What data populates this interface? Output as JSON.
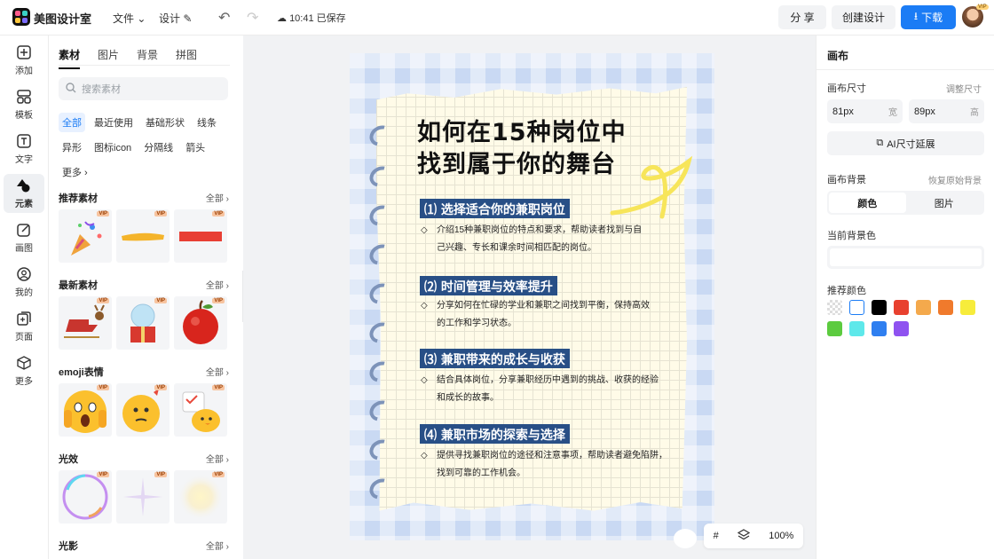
{
  "app": {
    "title": "美图设计室"
  },
  "topbar": {
    "file_menu": "文件",
    "design_menu": "设计",
    "save_status": "10:41 已保存",
    "share_label": "分 享",
    "create_label": "创建设计",
    "download_label": "下载",
    "avatar_badge": "VIP"
  },
  "rail": {
    "items": [
      {
        "label": "添加",
        "icon": "plus-square-icon"
      },
      {
        "label": "模板",
        "icon": "template-icon"
      },
      {
        "label": "文字",
        "icon": "text-icon"
      },
      {
        "label": "元素",
        "icon": "shapes-icon"
      },
      {
        "label": "画图",
        "icon": "pencil-icon"
      },
      {
        "label": "我的",
        "icon": "user-icon"
      },
      {
        "label": "页面",
        "icon": "page-add-icon"
      },
      {
        "label": "更多",
        "icon": "cube-icon"
      }
    ]
  },
  "panel": {
    "tabs": [
      "素材",
      "图片",
      "背景",
      "拼图"
    ],
    "search_placeholder": "搜索素材",
    "chips": [
      "全部",
      "最近使用",
      "基础形状",
      "线条",
      "异形",
      "图标icon",
      "分隔线",
      "箭头",
      "更多"
    ],
    "sections": [
      {
        "title": "推荐素材",
        "more": "全部"
      },
      {
        "title": "最新素材",
        "more": "全部"
      },
      {
        "title": "emoji表情",
        "more": "全部"
      },
      {
        "title": "光效",
        "more": "全部"
      },
      {
        "title": "光影",
        "more": "全部"
      }
    ],
    "vip_badge": "VIP"
  },
  "poster": {
    "title_line1": "如何在15种岗位中",
    "title_line2": "找到属于你的舞台",
    "sections": [
      {
        "heading": "⑴ 选择适合你的兼职岗位",
        "desc1": "介绍15种兼职岗位的特点和要求，帮助读者找到与自",
        "desc2": "己兴趣、专长和课余时间相匹配的岗位。"
      },
      {
        "heading": "⑵ 时间管理与效率提升",
        "desc1": "分享如何在忙碌的学业和兼职之间找到平衡，保持高效",
        "desc2": "的工作和学习状态。"
      },
      {
        "heading": "⑶ 兼职带来的成长与收获",
        "desc1": "结合具体岗位，分享兼职经历中遇到的挑战、收获的经验",
        "desc2": "和成长的故事。"
      },
      {
        "heading": "⑷ 兼职市场的探索与选择",
        "desc1": "提供寻找兼职岗位的途径和注意事项，帮助读者避免陷阱，",
        "desc2": "找到可靠的工作机会。"
      }
    ]
  },
  "zoom": {
    "level": "100%"
  },
  "right_panel": {
    "title": "画布",
    "size_label": "画布尺寸",
    "adjust_link": "调整尺寸",
    "width_value": "81px",
    "width_unit": "宽",
    "height_value": "89px",
    "height_unit": "高",
    "ai_extend_label": "AI尺寸延展",
    "bg_label": "画布背景",
    "restore_link": "恢复原始背景",
    "seg_color": "颜色",
    "seg_image": "图片",
    "current_bg_label": "当前背景色",
    "recommend_label": "推荐颜色",
    "swatches": [
      "transparent",
      "#ffffff",
      "#000000",
      "#e8412f",
      "#f4a94c",
      "#f07a2c",
      "#f7ec3b",
      "#5ccb3f",
      "#5ee8ea",
      "#2f7ff0",
      "#8f52f0"
    ]
  }
}
